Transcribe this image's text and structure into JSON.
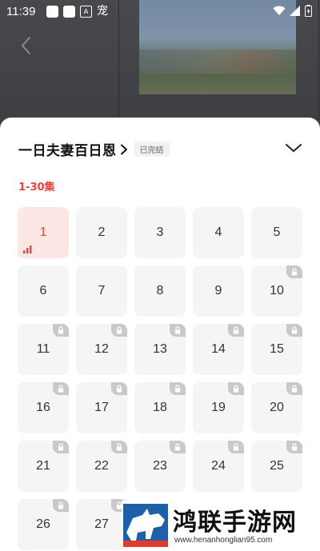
{
  "status_bar": {
    "time": "11:39",
    "left_glyphs": [
      "A",
      "宠"
    ]
  },
  "series": {
    "title": "一日夫妻百日恩",
    "status_tag": "已完结",
    "range_label": "1-30集",
    "current_episode": 1,
    "episodes": [
      {
        "num": "1",
        "locked": false
      },
      {
        "num": "2",
        "locked": false
      },
      {
        "num": "3",
        "locked": false
      },
      {
        "num": "4",
        "locked": false
      },
      {
        "num": "5",
        "locked": false
      },
      {
        "num": "6",
        "locked": false
      },
      {
        "num": "7",
        "locked": false
      },
      {
        "num": "8",
        "locked": false
      },
      {
        "num": "9",
        "locked": false
      },
      {
        "num": "10",
        "locked": true
      },
      {
        "num": "11",
        "locked": true
      },
      {
        "num": "12",
        "locked": true
      },
      {
        "num": "13",
        "locked": true
      },
      {
        "num": "14",
        "locked": true
      },
      {
        "num": "15",
        "locked": true
      },
      {
        "num": "16",
        "locked": true
      },
      {
        "num": "17",
        "locked": true
      },
      {
        "num": "18",
        "locked": true
      },
      {
        "num": "19",
        "locked": true
      },
      {
        "num": "20",
        "locked": true
      },
      {
        "num": "21",
        "locked": true
      },
      {
        "num": "22",
        "locked": true
      },
      {
        "num": "23",
        "locked": true
      },
      {
        "num": "24",
        "locked": true
      },
      {
        "num": "25",
        "locked": true
      },
      {
        "num": "26",
        "locked": true
      },
      {
        "num": "27",
        "locked": true
      }
    ]
  },
  "colors": {
    "accent": "#e8463d",
    "active_bg": "#fde7e5",
    "tile_bg": "#f5f5f5",
    "lock_badge": "#c9c9c9"
  },
  "watermark": {
    "title": "鸿联手游网",
    "url": "www.henanhonglian95.com"
  }
}
